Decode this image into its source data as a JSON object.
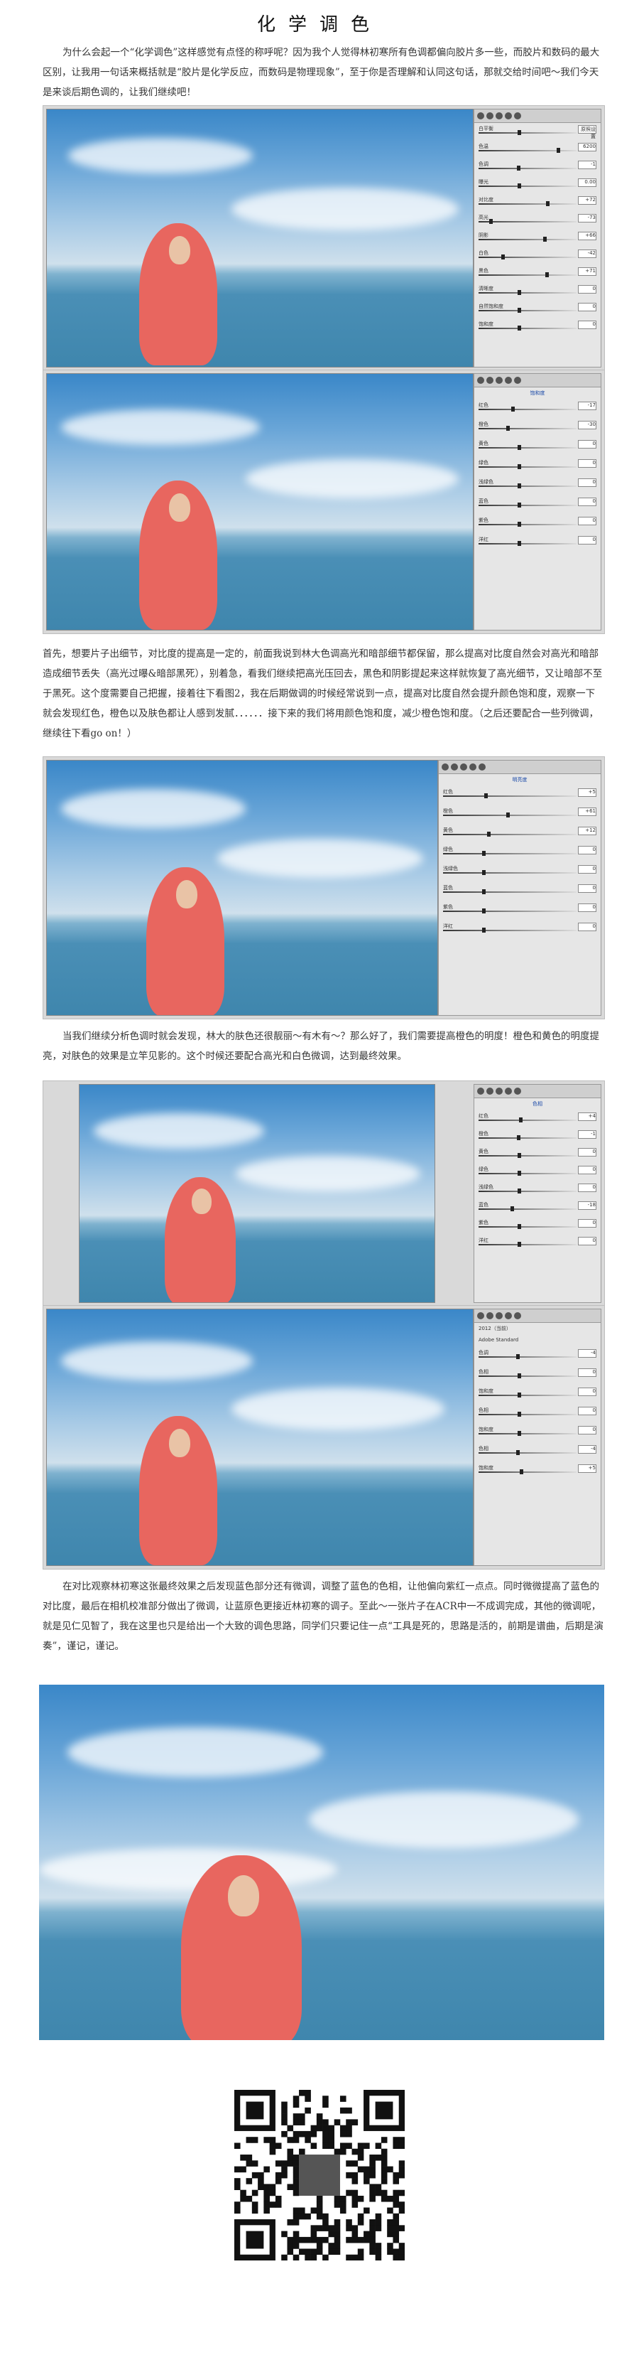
{
  "title": "化学调色",
  "paragraphs": {
    "intro": "为什么会起一个“化学调色”这样感觉有点怪的称呼呢？因为我个人觉得林初寒所有色调都偏向胶片多一些，而胶片和数码的最大区别，让我用一句话来概括就是“胶片是化学反应，而数码是物理现象”，至于你是否理解和认同这句话，那就交给时间吧～我们今天是来谈后期色调的，让我们继续吧！",
    "p2": "首先，想要片子出细节，对比度的提高是一定的，前面我说到林大色调高光和暗部细节都保留，那么提高对比度自然会对高光和暗部造成细节丢失（高光过曝&暗部黑死），别着急，看我们继续把高光压回去，黑色和阴影提起来这样就恢复了高光细节，又让暗部不至于黑死。这个度需要自己把握，接着往下看图2，我在后期做调的时候经常说到一点，提高对比度自然会提升颜色饱和度，观察一下就会发现红色，橙色以及肤色都让人感到发腻．．．．．．接下来的我们将用颜色饱和度，减少橙色饱和度。（之后还要配合一些列微调，继续往下看go on！）",
    "p3": "当我们继续分析色调时就会发现，林大的肤色还很靓丽～有木有～？那么好了，我们需要提高橙色的明度！橙色和黄色的明度提亮，对肤色的效果是立竿见影的。这个时候还要配合高光和白色微调，达到最终效果。",
    "p4": "在对比观察林初寒这张最终效果之后发现蓝色部分还有微调，调整了蓝色的色相，让他偏向紫红一点点。同时微微提高了蓝色的对比度，最后在相机校准部分做出了微调，让蓝原色更接近林初寒的调子。至此～一张片子在ACR中一不成调完成，其他的微调呢，就是见仁见智了，我在这里也只是给出一个大致的调色思路，同学们只要记住一点“工具是死的，思路是活的，前期是谱曲，后期是演奏”，谨记，谨记。"
  },
  "panels": {
    "basic": {
      "rows": [
        {
          "label": "白平衡",
          "value": "原照设置"
        },
        {
          "label": "色温",
          "value": "6200"
        },
        {
          "label": "色调",
          "value": "-1"
        },
        {
          "label": "曝光",
          "value": "0.00"
        },
        {
          "label": "对比度",
          "value": "+72"
        },
        {
          "label": "高光",
          "value": "-73"
        },
        {
          "label": "阴影",
          "value": "+66"
        },
        {
          "label": "白色",
          "value": "-42"
        },
        {
          "label": "黑色",
          "value": "+71"
        },
        {
          "label": "清晰度",
          "value": "0"
        },
        {
          "label": "自然饱和度",
          "value": "0"
        },
        {
          "label": "饱和度",
          "value": "0"
        }
      ]
    },
    "hsl_saturation": {
      "tab": "饱和度",
      "rows": [
        {
          "label": "红色",
          "value": "-17"
        },
        {
          "label": "橙色",
          "value": "-30"
        },
        {
          "label": "黄色",
          "value": "0"
        },
        {
          "label": "绿色",
          "value": "0"
        },
        {
          "label": "浅绿色",
          "value": "0"
        },
        {
          "label": "蓝色",
          "value": "0"
        },
        {
          "label": "紫色",
          "value": "0"
        },
        {
          "label": "洋红",
          "value": "0"
        }
      ]
    },
    "hsl_luminance": {
      "tab": "明亮度",
      "rows": [
        {
          "label": "红色",
          "value": "+5"
        },
        {
          "label": "橙色",
          "value": "+61"
        },
        {
          "label": "黄色",
          "value": "+12"
        },
        {
          "label": "绿色",
          "value": "0"
        },
        {
          "label": "浅绿色",
          "value": "0"
        },
        {
          "label": "蓝色",
          "value": "0"
        },
        {
          "label": "紫色",
          "value": "0"
        },
        {
          "label": "洋红",
          "value": "0"
        }
      ]
    },
    "hsl_hue": {
      "tab": "色相",
      "rows": [
        {
          "label": "红色",
          "value": "+4"
        },
        {
          "label": "橙色",
          "value": "-1"
        },
        {
          "label": "黄色",
          "value": "0"
        },
        {
          "label": "绿色",
          "value": "0"
        },
        {
          "label": "浅绿色",
          "value": "0"
        },
        {
          "label": "蓝色",
          "value": "-18"
        },
        {
          "label": "紫色",
          "value": "0"
        },
        {
          "label": "洋红",
          "value": "0"
        }
      ]
    },
    "calibration": {
      "process": "2012（当前）",
      "profile": "Adobe Standard",
      "rows": [
        {
          "label": "色调",
          "value": "-4"
        },
        {
          "label": "色相",
          "value": "0"
        },
        {
          "label": "饱和度",
          "value": "0"
        },
        {
          "label": "色相",
          "value": "0"
        },
        {
          "label": "饱和度",
          "value": "0"
        },
        {
          "label": "色相",
          "value": "-4"
        },
        {
          "label": "饱和度",
          "value": "+5"
        }
      ]
    }
  }
}
